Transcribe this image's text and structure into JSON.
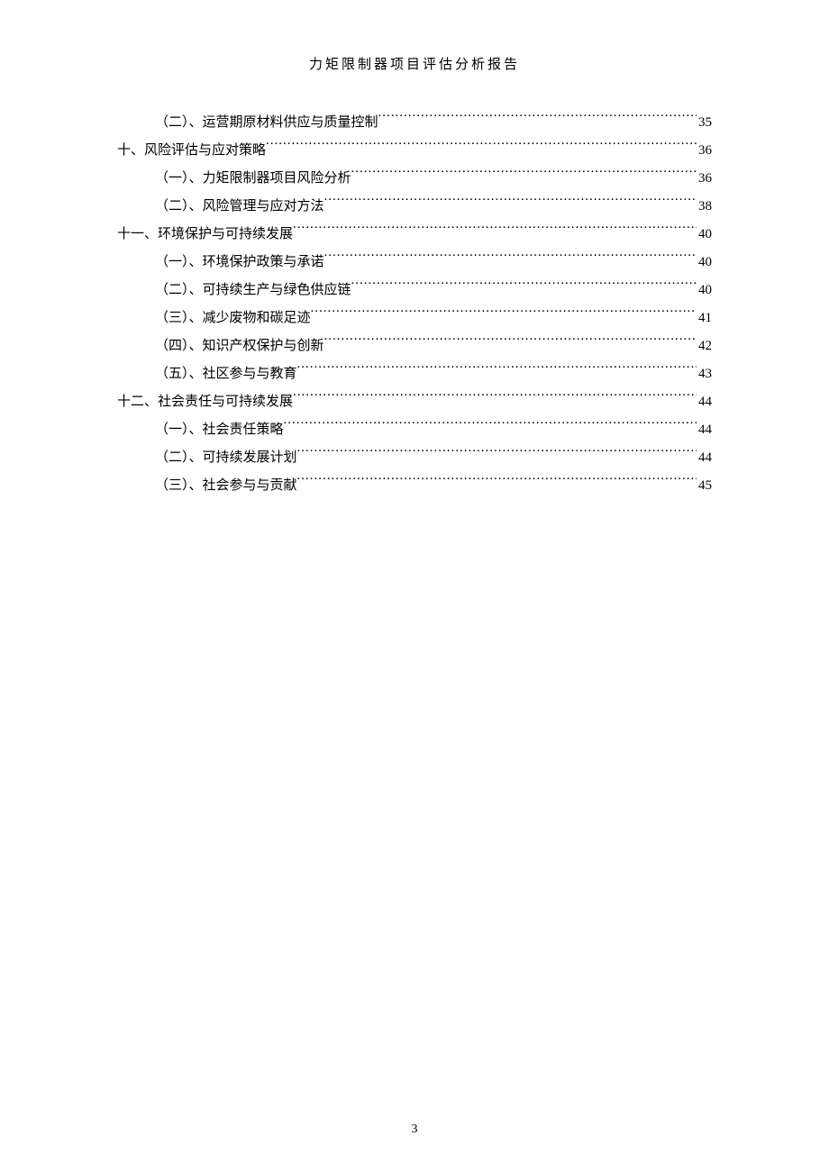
{
  "header": {
    "title": "力矩限制器项目评估分析报告"
  },
  "toc": {
    "entries": [
      {
        "level": 2,
        "label": "（二）、运营期原材料供应与质量控制",
        "page": "35"
      },
      {
        "level": 1,
        "label": "十、风险评估与应对策略",
        "page": "36"
      },
      {
        "level": 2,
        "label": "（一）、力矩限制器项目风险分析",
        "page": "36"
      },
      {
        "level": 2,
        "label": "（二）、风险管理与应对方法",
        "page": "38"
      },
      {
        "level": 1,
        "label": "十一、环境保护与可持续发展",
        "page": "40"
      },
      {
        "level": 2,
        "label": "（一）、环境保护政策与承诺",
        "page": "40"
      },
      {
        "level": 2,
        "label": "（二）、可持续生产与绿色供应链",
        "page": "40"
      },
      {
        "level": 2,
        "label": "（三）、减少废物和碳足迹",
        "page": "41"
      },
      {
        "level": 2,
        "label": "（四）、知识产权保护与创新",
        "page": "42"
      },
      {
        "level": 2,
        "label": "（五）、社区参与与教育",
        "page": "43"
      },
      {
        "level": 1,
        "label": "十二、社会责任与可持续发展",
        "page": "44"
      },
      {
        "level": 2,
        "label": "（一）、社会责任策略",
        "page": "44"
      },
      {
        "level": 2,
        "label": "（二）、可持续发展计划",
        "page": "44"
      },
      {
        "level": 2,
        "label": "（三）、社会参与与贡献",
        "page": "45"
      }
    ]
  },
  "footer": {
    "page_number": "3"
  }
}
